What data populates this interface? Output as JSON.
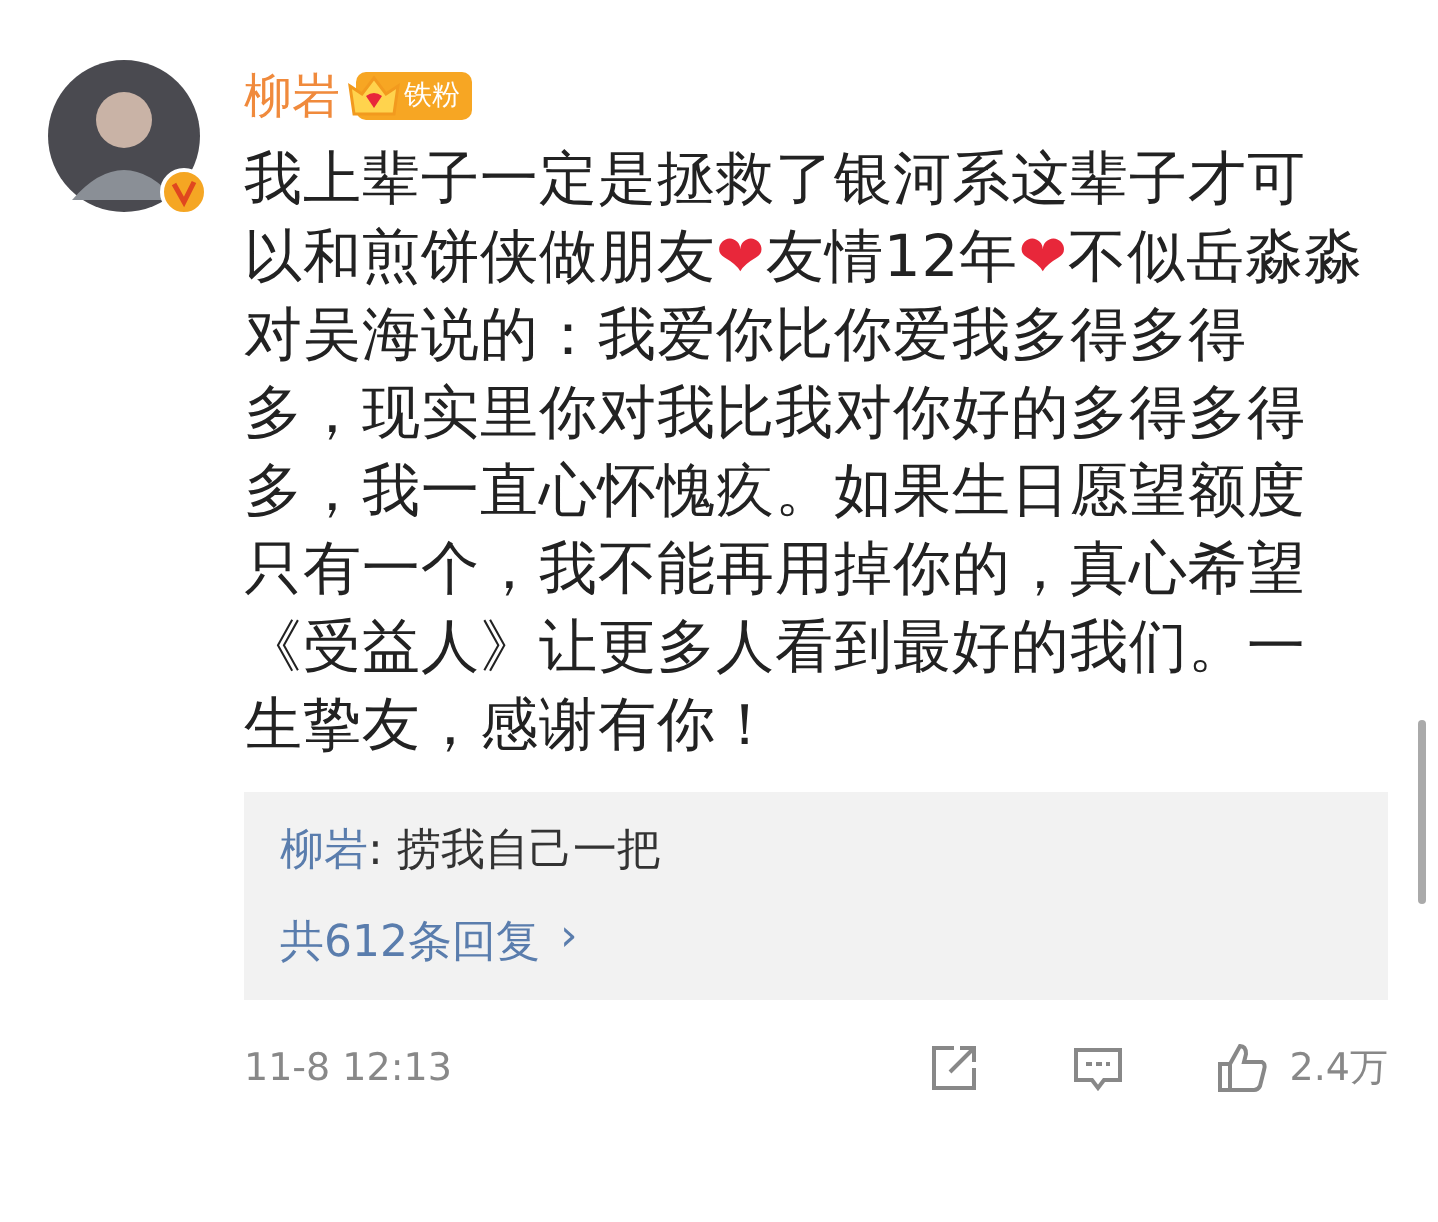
{
  "comment": {
    "author": "柳岩",
    "badge": "铁粉",
    "body": [
      {
        "kind": "text",
        "text": "我上辈子一定是拯救了银河系这辈子才可以和煎饼侠做朋友"
      },
      {
        "kind": "heart",
        "text": "❤"
      },
      {
        "kind": "text",
        "text": "友情12年"
      },
      {
        "kind": "heart",
        "text": "❤"
      },
      {
        "kind": "text",
        "text": "不似岳淼淼对吴海说的：我爱你比你爱我多得多得多，现实里你对我比我对你好的多得多得多，我一直心怀愧疚。如果生日愿望额度只有一个，我不能再用掉你的，真心希望《受益人》让更多人看到最好的我们。一生挚友，感谢有你！"
      }
    ],
    "reply": {
      "author": "柳岩",
      "separator": ":",
      "text": "捞我自己一把"
    },
    "reply_count": "共612条回复",
    "reply_arrow": "›",
    "time": "11-8 12:13",
    "likes": "2.4万"
  }
}
